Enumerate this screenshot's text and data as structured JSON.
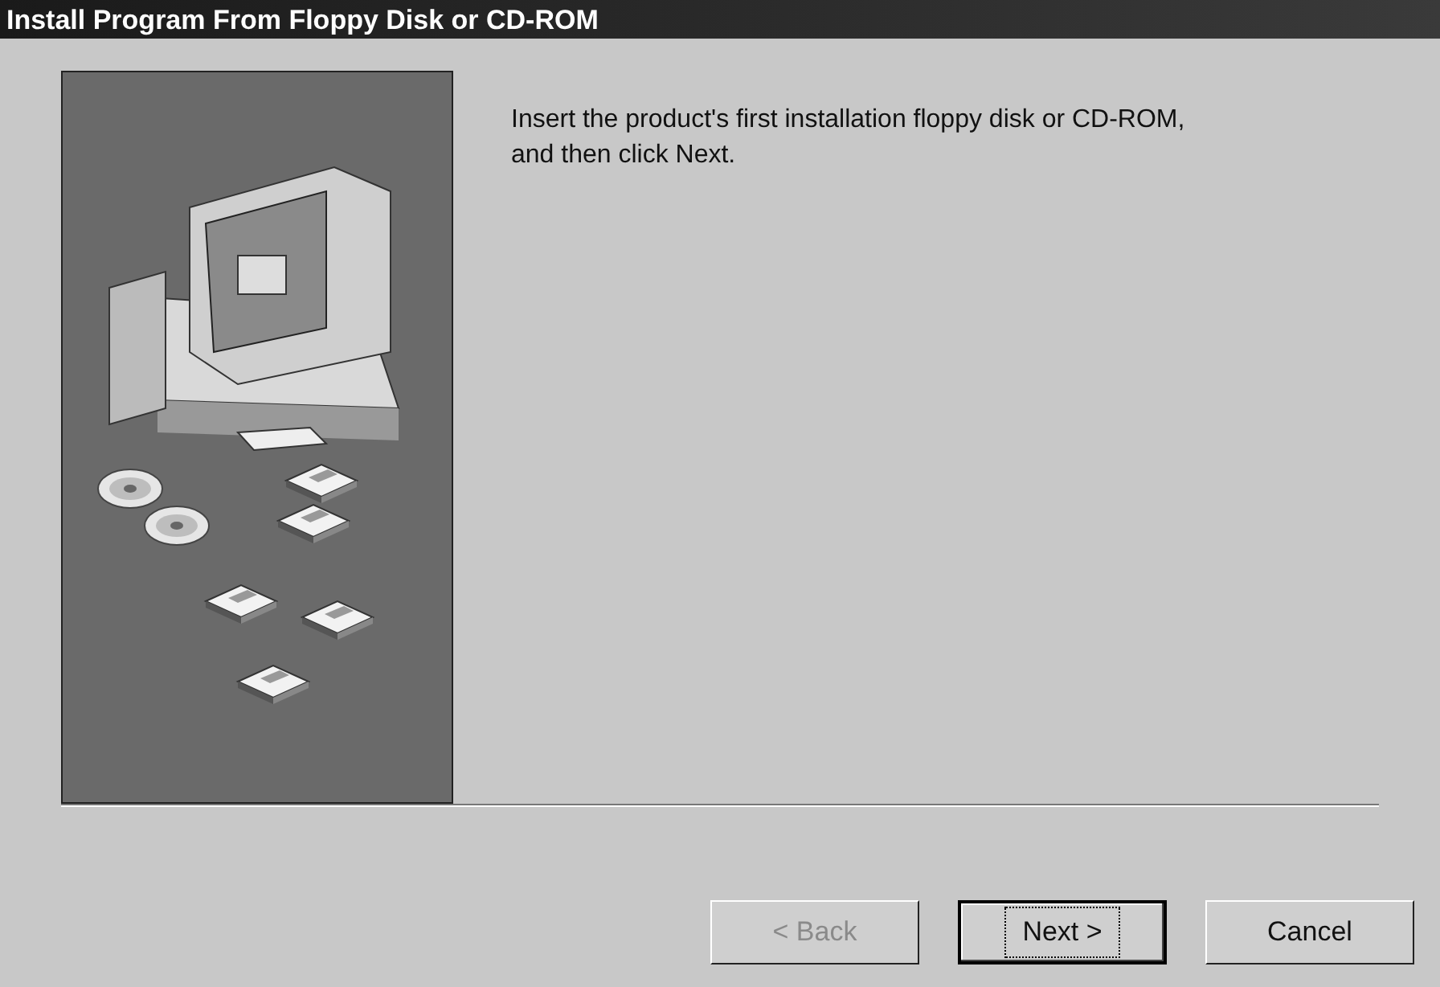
{
  "window": {
    "title": "Install Program From Floppy Disk or CD-ROM"
  },
  "instructions": "Insert the product's first installation floppy disk or CD-ROM,\nand then click Next.",
  "buttons": [
    {
      "label": "< Back",
      "disabled": true,
      "default": false
    },
    {
      "label": "Next >",
      "disabled": false,
      "default": true
    },
    {
      "label": "Cancel",
      "disabled": false,
      "default": false
    }
  ]
}
